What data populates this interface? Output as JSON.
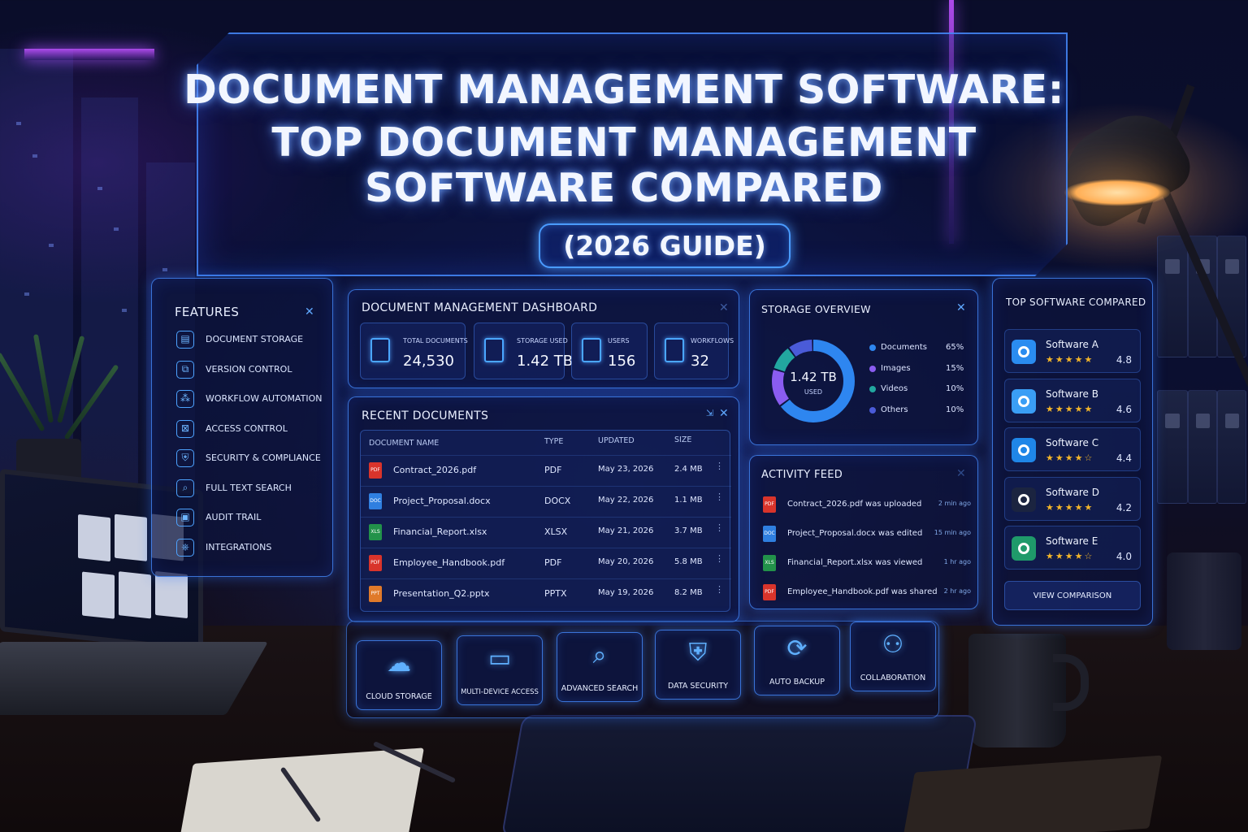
{
  "title": {
    "line1": "DOCUMENT MANAGEMENT SOFTWARE:",
    "line2": "TOP DOCUMENT MANAGEMENT",
    "line3": "SOFTWARE COMPARED",
    "guide": "(2026 GUIDE)"
  },
  "features": {
    "title": "FEATURES",
    "items": [
      {
        "label": "DOCUMENT STORAGE",
        "icon": "document-icon"
      },
      {
        "label": "VERSION CONTROL",
        "icon": "version-icon"
      },
      {
        "label": "WORKFLOW AUTOMATION",
        "icon": "workflow-icon"
      },
      {
        "label": "ACCESS CONTROL",
        "icon": "lock-icon"
      },
      {
        "label": "SECURITY & COMPLIANCE",
        "icon": "shield-icon"
      },
      {
        "label": "FULL TEXT SEARCH",
        "icon": "search-icon"
      },
      {
        "label": "AUDIT TRAIL",
        "icon": "audit-icon"
      },
      {
        "label": "INTEGRATIONS",
        "icon": "integrations-icon"
      }
    ]
  },
  "dashboard": {
    "title": "DOCUMENT MANAGEMENT DASHBOARD",
    "stats": [
      {
        "label": "TOTAL DOCUMENTS",
        "value": "24,530"
      },
      {
        "label": "STORAGE USED",
        "value": "1.42 TB"
      },
      {
        "label": "USERS",
        "value": "156"
      },
      {
        "label": "WORKFLOWS",
        "value": "32"
      }
    ]
  },
  "recent": {
    "title": "RECENT DOCUMENTS",
    "headers": [
      "DOCUMENT NAME",
      "TYPE",
      "UPDATED",
      "SIZE"
    ],
    "rows": [
      {
        "name": "Contract_2026.pdf",
        "type": "PDF",
        "updated": "May 23, 2026",
        "size": "2.4 MB",
        "icon": "PDF",
        "color": "#d9342b"
      },
      {
        "name": "Project_Proposal.docx",
        "type": "DOCX",
        "updated": "May 22, 2026",
        "size": "1.1 MB",
        "icon": "DOC",
        "color": "#2f7fe0"
      },
      {
        "name": "Financial_Report.xlsx",
        "type": "XLSX",
        "updated": "May 21, 2026",
        "size": "3.7 MB",
        "icon": "XLS",
        "color": "#22924a"
      },
      {
        "name": "Employee_Handbook.pdf",
        "type": "PDF",
        "updated": "May 20, 2026",
        "size": "5.8 MB",
        "icon": "PDF",
        "color": "#d9342b"
      },
      {
        "name": "Presentation_Q2.pptx",
        "type": "PPTX",
        "updated": "May 19, 2026",
        "size": "8.2 MB",
        "icon": "PPT",
        "color": "#e07a2a"
      }
    ]
  },
  "storage": {
    "title": "STORAGE OVERVIEW",
    "center_value": "1.42 TB",
    "center_label": "USED",
    "segments": [
      {
        "label": "Documents",
        "percent": "65%",
        "value": 65,
        "color": "#2e86f0"
      },
      {
        "label": "Images",
        "percent": "15%",
        "value": 15,
        "color": "#8a5cf0"
      },
      {
        "label": "Videos",
        "percent": "10%",
        "value": 10,
        "color": "#22a7a0"
      },
      {
        "label": "Others",
        "percent": "10%",
        "value": 10,
        "color": "#4a5bd8"
      }
    ]
  },
  "activity": {
    "title": "ACTIVITY FEED",
    "items": [
      {
        "text": "Contract_2026.pdf was uploaded",
        "time": "2 min ago",
        "icon": "PDF",
        "color": "#d9342b"
      },
      {
        "text": "Project_Proposal.docx was edited",
        "time": "15 min ago",
        "icon": "DOC",
        "color": "#2f7fe0"
      },
      {
        "text": "Financial_Report.xlsx was viewed",
        "time": "1 hr ago",
        "icon": "XLS",
        "color": "#22924a"
      },
      {
        "text": "Employee_Handbook.pdf was shared",
        "time": "2 hr ago",
        "icon": "PDF",
        "color": "#d9342b"
      }
    ]
  },
  "top": {
    "title": "TOP SOFTWARE COMPARED",
    "items": [
      {
        "name": "Software A",
        "rating": 4.8,
        "score": "4.8",
        "stars": "★★★★★",
        "color": "#2a8cf0"
      },
      {
        "name": "Software B",
        "rating": 4.6,
        "score": "4.6",
        "stars": "★★★★★",
        "color": "#3a9ef5"
      },
      {
        "name": "Software C",
        "rating": 4.4,
        "score": "4.4",
        "stars": "★★★★☆",
        "color": "#1f86e8"
      },
      {
        "name": "Software D",
        "rating": 4.2,
        "score": "4.2",
        "stars": "★★★★★",
        "color": "#1b2440"
      },
      {
        "name": "Software E",
        "rating": 4.0,
        "score": "4.0",
        "stars": "★★★★☆",
        "color": "#1f9a6a"
      }
    ],
    "button": "VIEW COMPARISON"
  },
  "tiles": [
    {
      "label": "CLOUD STORAGE",
      "icon": "cloud-icon",
      "glyph": "☁"
    },
    {
      "label": "MULTI-DEVICE ACCESS",
      "icon": "devices-icon",
      "glyph": "▭"
    },
    {
      "label": "ADVANCED SEARCH",
      "icon": "search-icon",
      "glyph": "⌕"
    },
    {
      "label": "DATA SECURITY",
      "icon": "shield-icon",
      "glyph": "⛨"
    },
    {
      "label": "AUTO BACKUP",
      "icon": "backup-icon",
      "glyph": "⟳"
    },
    {
      "label": "COLLABORATION",
      "icon": "team-icon",
      "glyph": "⚇"
    }
  ]
}
